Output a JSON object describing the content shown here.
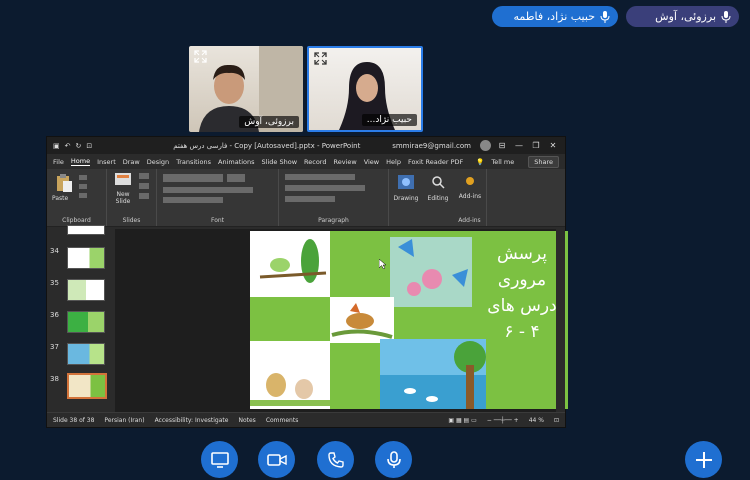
{
  "participants": {
    "chip_1": "حبیب نژاد، فاطمه",
    "chip_2": "برزوئی، آوش",
    "tile_1_name": "برزوئی، آوش",
    "tile_2_name": "حبیب نژاد..."
  },
  "ppt": {
    "title": "فارسی درس هفتم - Copy [Autosaved].pptx  -  PowerPoint",
    "email": "smmirae9@gmail.com",
    "window_controls": [
      "—",
      "❐",
      "✕"
    ],
    "menu": [
      "File",
      "Home",
      "Insert",
      "Draw",
      "Design",
      "Transitions",
      "Animations",
      "Slide Show",
      "Record",
      "Review",
      "View",
      "Help",
      "Foxit Reader PDF",
      "Tell me"
    ],
    "share": "Share",
    "ribbon_groups": {
      "clipboard": "Clipboard",
      "slides": "Slides",
      "font": "Font",
      "paragraph": "Paragraph",
      "addins": "Add-ins"
    },
    "ribbon_buttons": {
      "paste": "Paste",
      "new_slide": "New Slide",
      "drawing": "Drawing",
      "editing": "Editing",
      "addins": "Add-ins"
    },
    "thumb_numbers": [
      "34",
      "35",
      "36",
      "37",
      "38"
    ],
    "slide_title_lines": [
      "پرسش",
      "مروری",
      "درس های",
      "۴ - ۶"
    ],
    "status": {
      "slide": "Slide 38 of 38",
      "lang": "Persian (Iran)",
      "accessibility": "Accessibility: Investigate",
      "notes": "Notes",
      "comments": "Comments",
      "zoom": "44 %"
    }
  },
  "colors": {
    "background": "#0c1b2f",
    "accent": "#1f6fd1",
    "slide_green": "#7cc142"
  },
  "controls": [
    "screen-share-icon",
    "camera-icon",
    "phone-icon",
    "microphone-icon",
    "plus-icon"
  ]
}
